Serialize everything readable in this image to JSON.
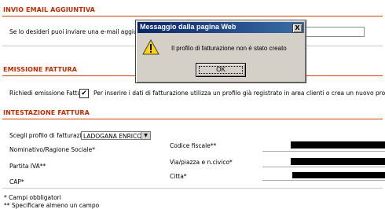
{
  "sections": {
    "email": {
      "title": "INVIO EMAIL AGGIUNTIVA",
      "text": "Se lo desideri puoi inviare una e-mail aggiuntiva c",
      "input_value": ""
    },
    "invoice": {
      "title": "EMISSIONE FATTURA",
      "checkbox_label": "Richiedi emissione Fattura",
      "checkbox_checked": true,
      "checkbox_mark": "✔",
      "note": "Per inserire i dati di fatturazione utilizza un profilo già registrato in area clienti o crea un nuovo profilo"
    },
    "billing": {
      "title": "INTESTAZIONE FATTURA",
      "profile_label": "Scegli profilo di fatturazione",
      "profile_value": "LADOGANA ENRICO",
      "left_fields": [
        "Nominativo/Ragione Sociale*",
        "Partita IVA**",
        "CAP*"
      ],
      "right_fields": [
        "Codice fiscale**",
        "Via/piazza e n.civico*",
        "Citta*"
      ]
    }
  },
  "footnotes": [
    "* Campi obbligatori",
    "** Specificare almeno un campo"
  ],
  "dialog": {
    "title": "Messaggio dalla pagina Web",
    "close_symbol": "X",
    "message": "Il profilo di fatturazione non è stato creato",
    "ok_label": "OK"
  },
  "colors": {
    "section_title": "#c22a00",
    "section_rule": "#d43c00",
    "dialog_titlebar": "#0a246a"
  },
  "icons": [
    "warning-icon",
    "close-icon",
    "dropdown-arrow-icon",
    "checkmark-icon"
  ]
}
